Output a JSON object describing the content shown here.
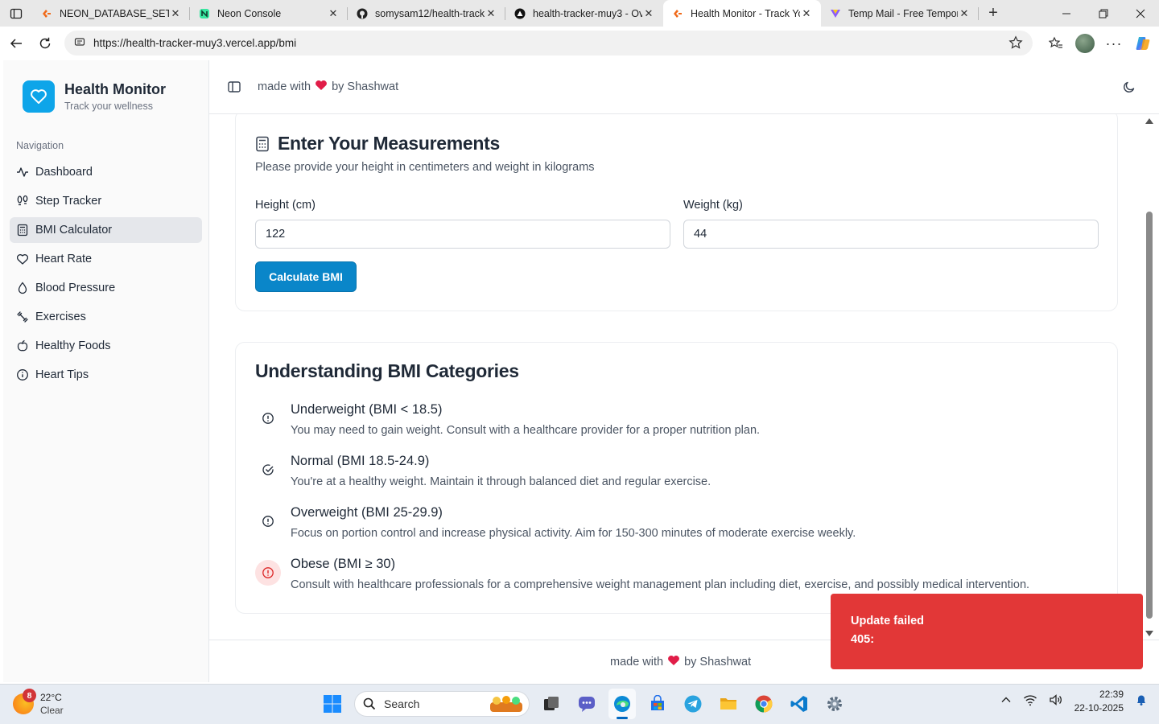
{
  "browser": {
    "tabs": [
      {
        "label": "NEON_DATABASE_SETUP",
        "icon": "document-icon"
      },
      {
        "label": "Neon Console",
        "icon": "neon-icon"
      },
      {
        "label": "somysam12/health-track",
        "icon": "github-icon"
      },
      {
        "label": "health-tracker-muy3 - Ov",
        "icon": "vercel-icon"
      },
      {
        "label": "Health Monitor - Track Yo",
        "icon": "document-icon",
        "active": true
      },
      {
        "label": "Temp Mail - Free Tempor",
        "icon": "tempmail-icon"
      }
    ],
    "url": "https://health-tracker-muy3.vercel.app/bmi"
  },
  "sidebar": {
    "brand_title": "Health Monitor",
    "brand_subtitle": "Track your wellness",
    "nav_heading": "Navigation",
    "items": [
      {
        "label": "Dashboard",
        "icon": "activity-icon"
      },
      {
        "label": "Step Tracker",
        "icon": "footprints-icon"
      },
      {
        "label": "BMI Calculator",
        "icon": "calculator-icon",
        "active": true
      },
      {
        "label": "Heart Rate",
        "icon": "heart-icon"
      },
      {
        "label": "Blood Pressure",
        "icon": "droplet-icon"
      },
      {
        "label": "Exercises",
        "icon": "dumbbell-icon"
      },
      {
        "label": "Healthy Foods",
        "icon": "apple-icon"
      },
      {
        "label": "Heart Tips",
        "icon": "info-icon"
      }
    ]
  },
  "header": {
    "made_with": "made with",
    "by": "by Shashwat"
  },
  "measurements": {
    "title": "Enter Your Measurements",
    "description": "Please provide your height in centimeters and weight in kilograms",
    "height_label": "Height (cm)",
    "height_value": "122",
    "weight_label": "Weight (kg)",
    "weight_value": "44",
    "button": "Calculate BMI"
  },
  "categories": {
    "title": "Understanding BMI Categories",
    "items": [
      {
        "title": "Underweight (BMI < 18.5)",
        "desc": "You may need to gain weight. Consult with a healthcare provider for a proper nutrition plan.",
        "icon": "alert-circle-icon"
      },
      {
        "title": "Normal (BMI 18.5-24.9)",
        "desc": "You're at a healthy weight. Maintain it through balanced diet and regular exercise.",
        "icon": "check-circle-icon"
      },
      {
        "title": "Overweight (BMI 25-29.9)",
        "desc": "Focus on portion control and increase physical activity. Aim for 150-300 minutes of moderate exercise weekly.",
        "icon": "alert-circle-icon"
      },
      {
        "title": "Obese (BMI ≥ 30)",
        "desc": "Consult with healthcare professionals for a comprehensive weight management plan including diet, exercise, and possibly medical intervention.",
        "icon": "alert-circle-icon",
        "highlight": true
      }
    ]
  },
  "footer": {
    "made_with": "made with",
    "by": "by Shashwat"
  },
  "toast": {
    "title": "Update failed",
    "message": "405:",
    "color": "#e23737"
  },
  "taskbar": {
    "weather_badge": "8",
    "temperature": "22°C",
    "condition": "Clear",
    "search_label": "Search",
    "time": "22:39",
    "date": "22-10-2025"
  },
  "colors": {
    "accent": "#0a86c9",
    "brand_logo": "#0ea5e9",
    "danger": "#e23737",
    "heart": "#e11d48"
  }
}
